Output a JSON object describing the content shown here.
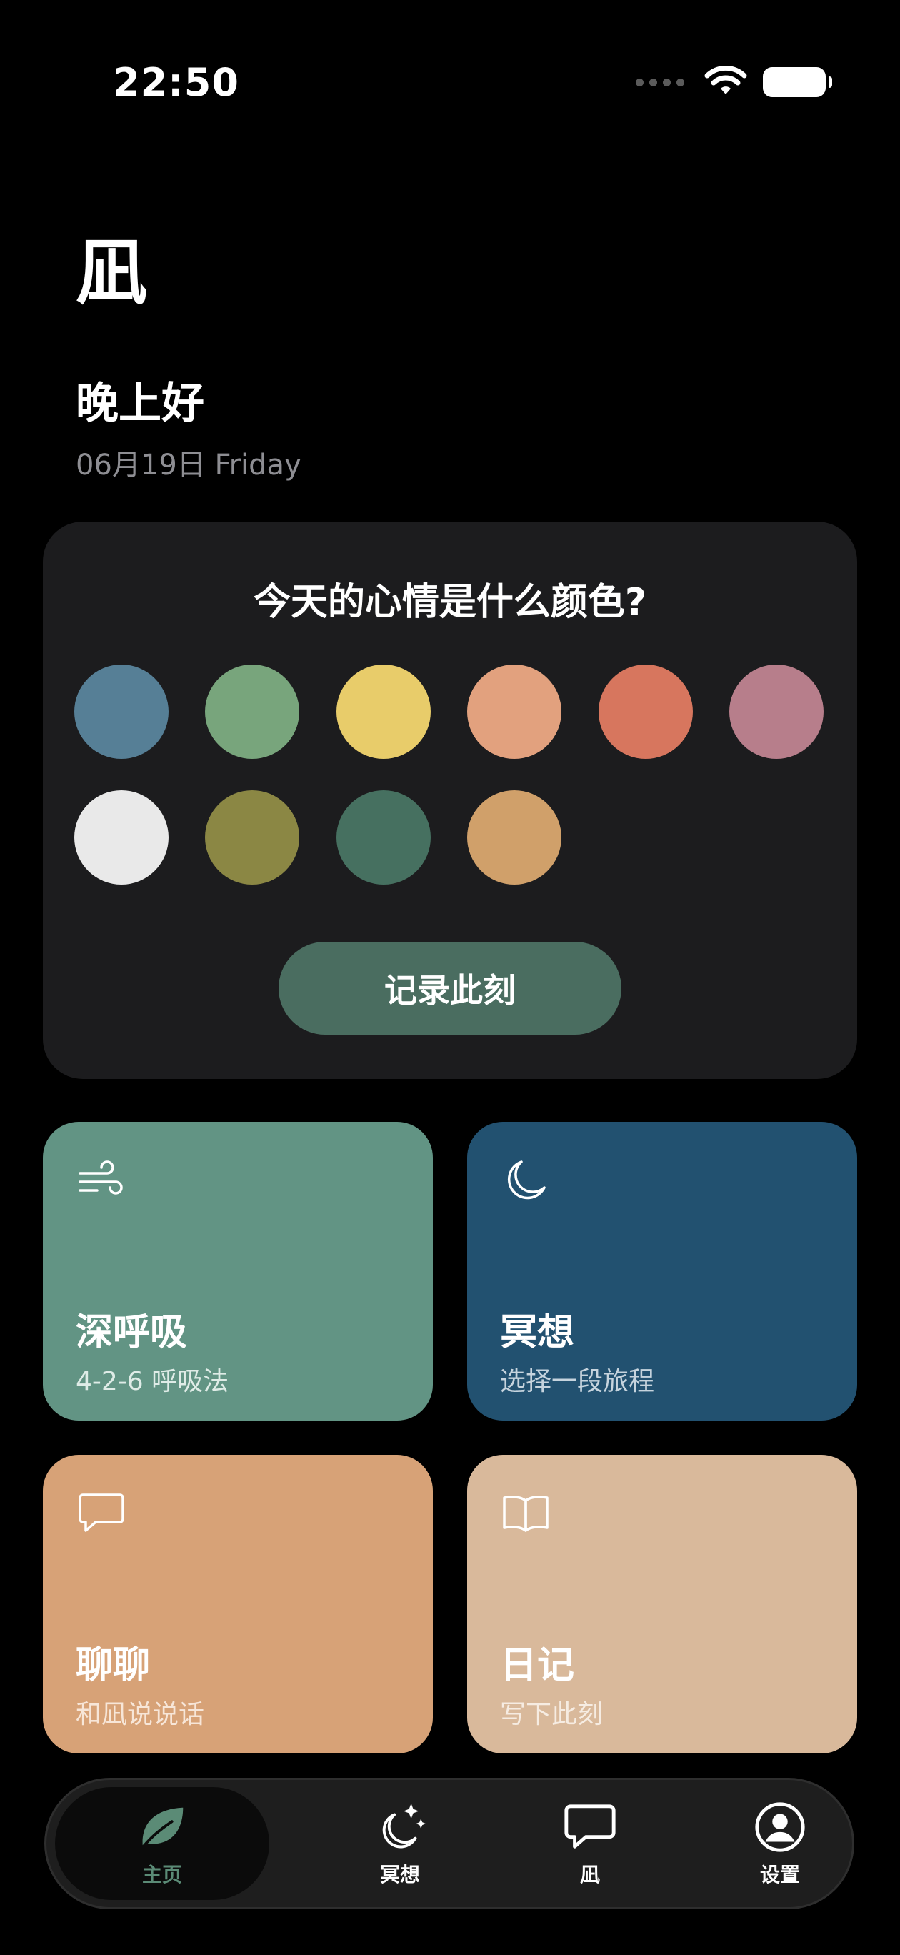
{
  "status": {
    "time": "22:50"
  },
  "header": {
    "title": "凪",
    "greeting": "晚上好",
    "date": "06月19日 Friday"
  },
  "mood": {
    "question": "今天的心情是什么颜色?",
    "colors": [
      "#567f96",
      "#78a57c",
      "#e8cc6a",
      "#e2a17e",
      "#d7765e",
      "#b77e8b",
      "#e9e9e9",
      "#8b8744",
      "#467060",
      "#d0a06a"
    ],
    "record_label": "记录此刻"
  },
  "tiles": {
    "breathe": {
      "title": "深呼吸",
      "subtitle": "4-2-6 呼吸法",
      "color": "#629484"
    },
    "meditate": {
      "title": "冥想",
      "subtitle": "选择一段旅程",
      "color": "#225170"
    },
    "chat": {
      "title": "聊聊",
      "subtitle": "和凪说说话",
      "color": "#d7a277"
    },
    "journal": {
      "title": "日记",
      "subtitle": "写下此刻",
      "color": "#d9b99b"
    }
  },
  "tabbar": {
    "home": "主页",
    "meditate": "冥想",
    "nagi": "凪",
    "settings": "设置",
    "active_color": "#5b8b76"
  }
}
